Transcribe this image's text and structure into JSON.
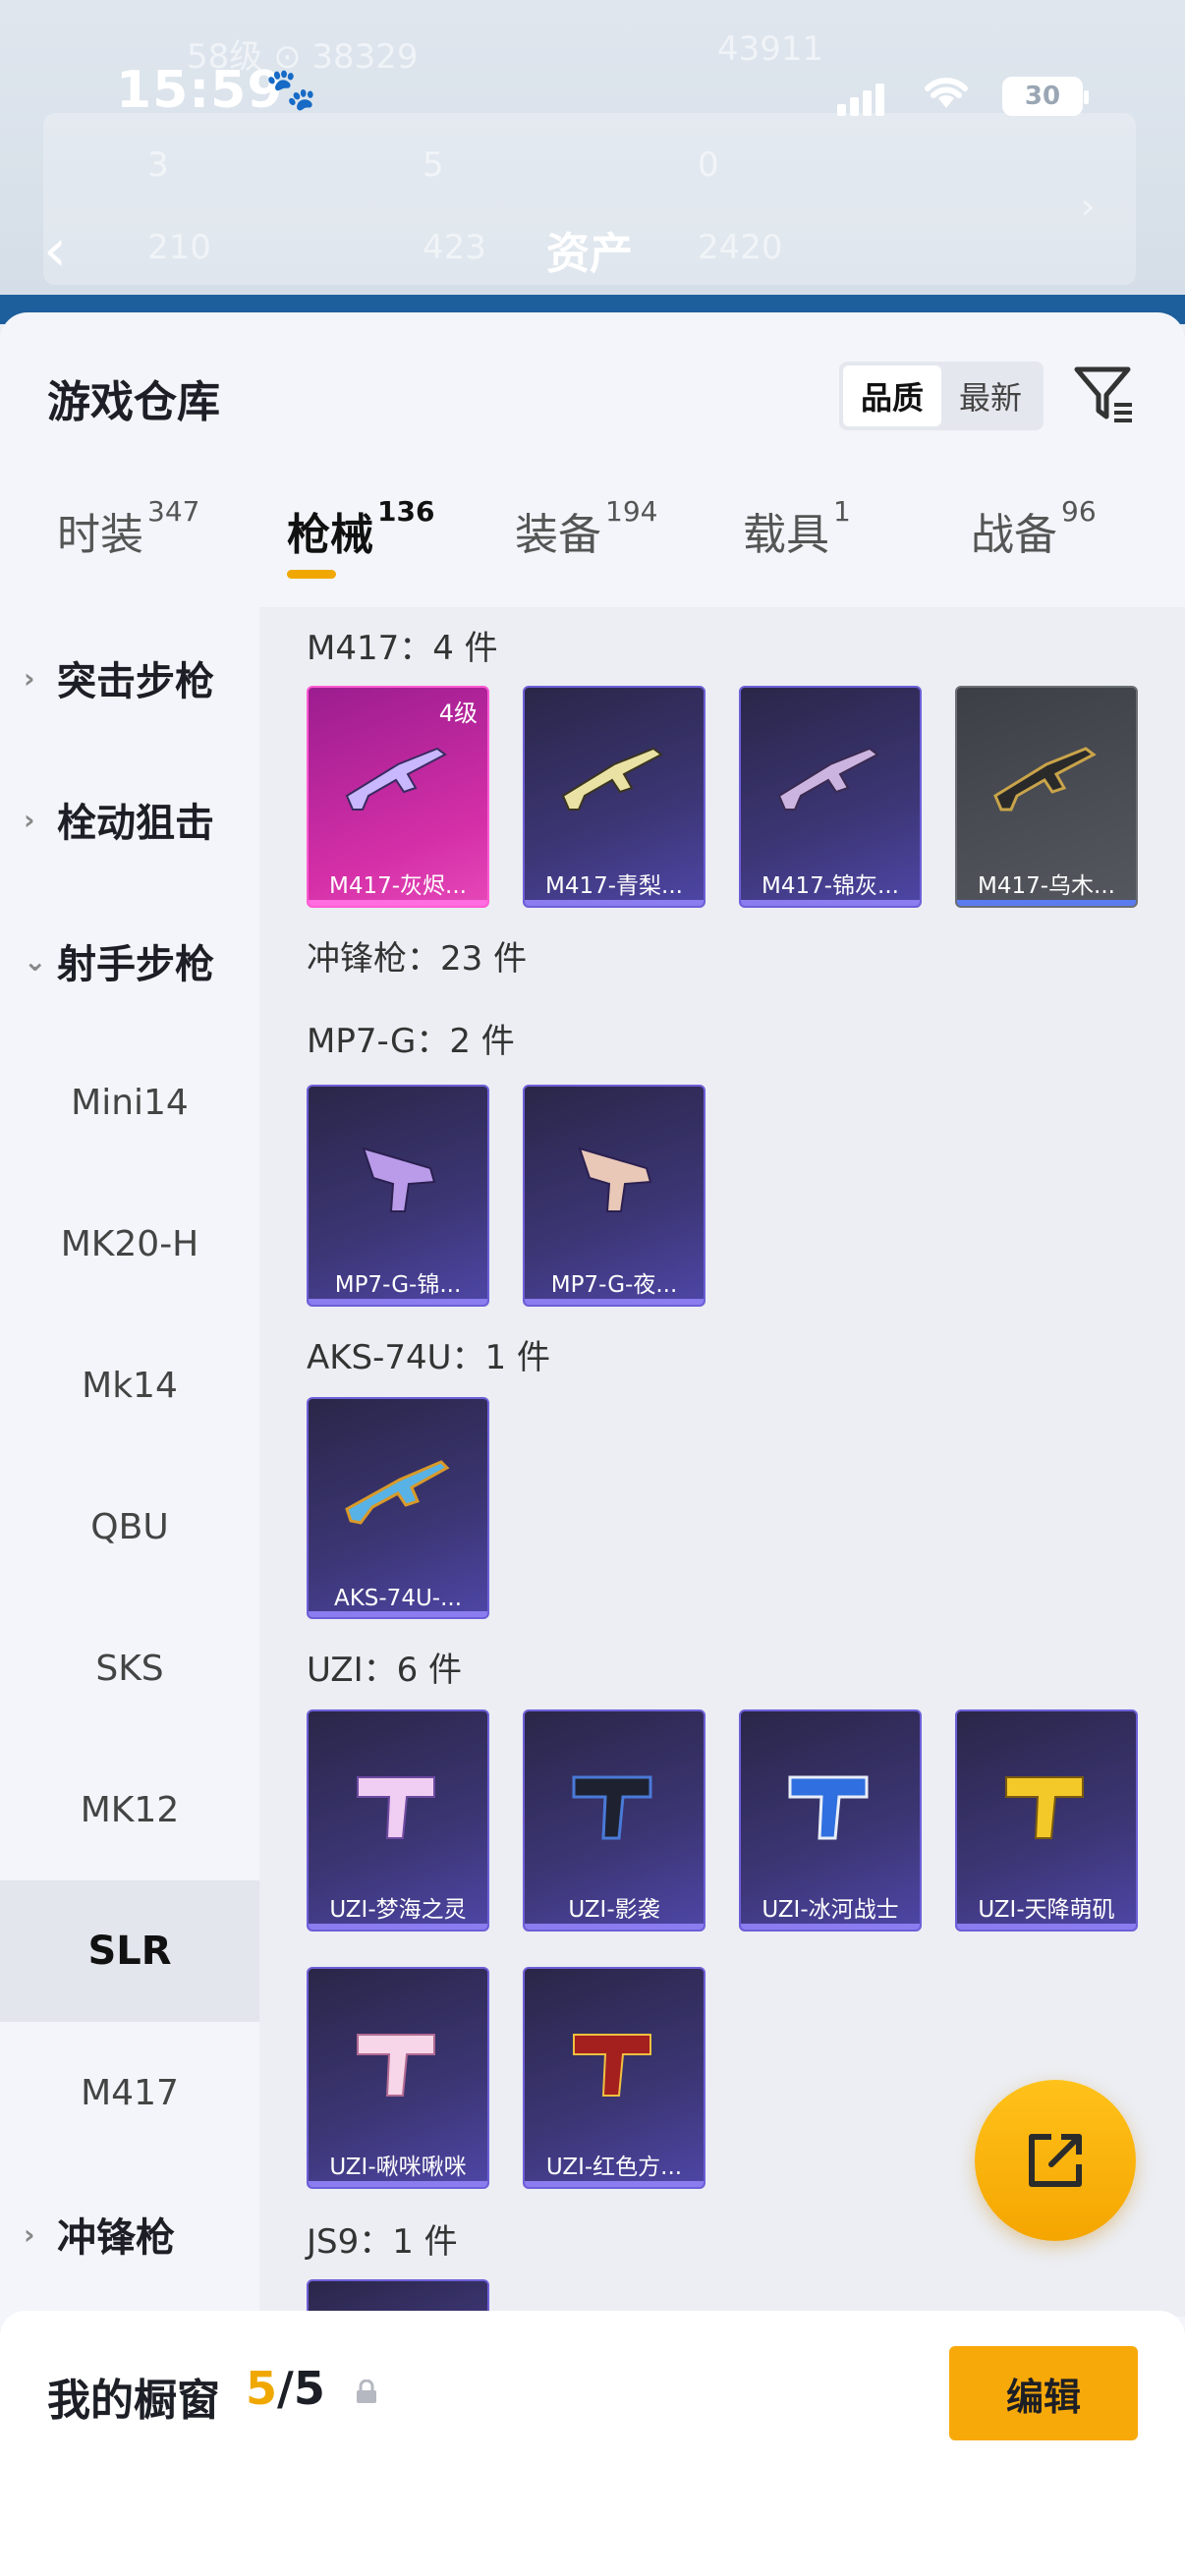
{
  "status_bar": {
    "time": "15:59",
    "battery": "30"
  },
  "background_header": {
    "faint_left": "58级 ⊙ 38329",
    "faint_right": "43911",
    "stat1": "3",
    "stat2": "5",
    "stat3": "0",
    "stat4": "210",
    "stat5": "423",
    "stat6": "2420",
    "title": "资产"
  },
  "sheet": {
    "title": "游戏仓库",
    "sort_options": [
      "品质",
      "最新"
    ],
    "active_sort": "品质"
  },
  "tabs": [
    {
      "label": "时装",
      "count": "347"
    },
    {
      "label": "枪械",
      "count": "136"
    },
    {
      "label": "装备",
      "count": "194"
    },
    {
      "label": "载具",
      "count": "1"
    },
    {
      "label": "战备",
      "count": "96"
    }
  ],
  "sidebar": {
    "cat_assault": "突击步枪",
    "cat_bolt": "栓动狙击",
    "cat_marksman": "射手步枪",
    "sub": [
      "Mini14",
      "MK20-H",
      "Mk14",
      "QBU",
      "SKS",
      "MK12",
      "SLR",
      "M417"
    ],
    "cat_smg": "冲锋枪"
  },
  "content": {
    "m417_label": "M417：4 件",
    "m417_cards": [
      "M417-灰烬...",
      "M417-青梨...",
      "M417-锦灰...",
      "M417-乌木..."
    ],
    "m417_level": "4级",
    "smg_label": "冲锋枪：23 件",
    "mp7_label": "MP7-G：2 件",
    "mp7_cards": [
      "MP7-G-锦...",
      "MP7-G-夜..."
    ],
    "aks_label": "AKS-74U：1 件",
    "aks_cards": [
      "AKS-74U-..."
    ],
    "uzi_label": "UZI：6 件",
    "uzi_cards": [
      "UZI-梦海之灵",
      "UZI-影袭",
      "UZI-冰河战士",
      "UZI-天降萌矶",
      "UZI-啾咪啾咪",
      "UZI-红色方..."
    ],
    "js9_label": "JS9：1 件"
  },
  "bottom_bar": {
    "showcase_label": "我的橱窗",
    "current": "5",
    "total": "/5",
    "edit_label": "编辑"
  },
  "colors": {
    "accent": "#f8a90a",
    "card_purple": "#3c3675",
    "card_pink": "#d52fa8"
  }
}
